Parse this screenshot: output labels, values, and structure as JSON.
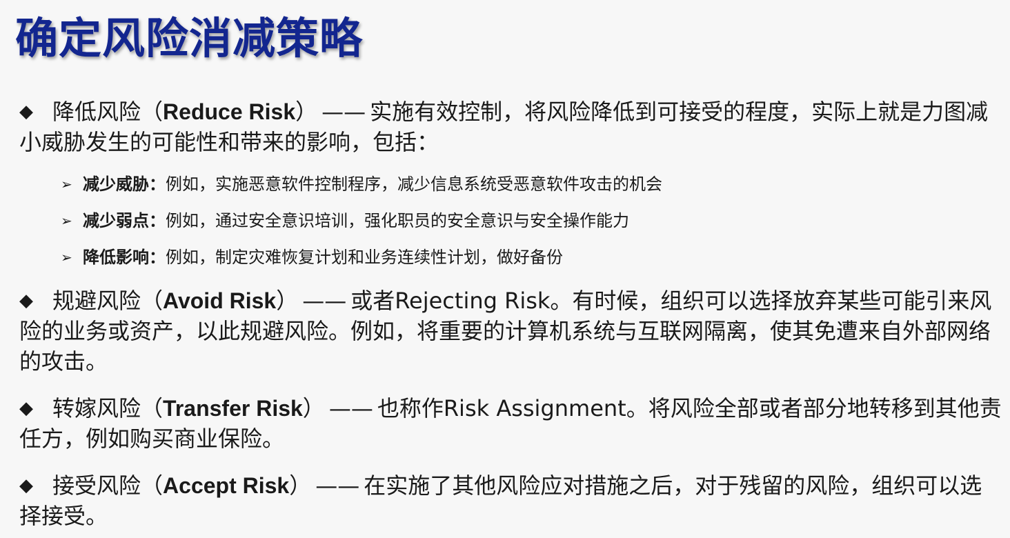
{
  "title": "确定风险消减策略",
  "sections": [
    {
      "name_cn": "降低风险",
      "name_en": "Reduce Risk",
      "description": "实施有效控制，将风险降低到可接受的程度，实际上就是力图减小威胁发生的可能性和带来的影响，包括：",
      "sub_items": [
        {
          "label": "减少威胁：",
          "text": "例如，实施恶意软件控制程序，减少信息系统受恶意软件攻击的机会"
        },
        {
          "label": "减少弱点：",
          "text": "例如，通过安全意识培训，强化职员的安全意识与安全操作能力"
        },
        {
          "label": "降低影响：",
          "text": "例如，制定灾难恢复计划和业务连续性计划，做好备份"
        }
      ]
    },
    {
      "name_cn": "规避风险",
      "name_en": "Avoid Risk",
      "description": "或者Rejecting Risk。有时候，组织可以选择放弃某些可能引来风险的业务或资产，以此规避风险。例如，将重要的计算机系统与互联网隔离，使其免遭来自外部网络的攻击。"
    },
    {
      "name_cn": "转嫁风险",
      "name_en": "Transfer Risk",
      "description": "也称作Risk Assignment。将风险全部或者部分地转移到其他责任方，例如购买商业保险。"
    },
    {
      "name_cn": "接受风险",
      "name_en": "Accept Risk",
      "description": "在实施了其他风险应对措施之后，对于残留的风险，组织可以选择接受。"
    }
  ],
  "symbols": {
    "bullet": "◆",
    "sub_bullet": "➢",
    "open_paren": "（",
    "close_paren": "）",
    "dash": "——"
  },
  "colors": {
    "title": "#13268f",
    "text": "#1a1a1a",
    "background": "#f7f7f7"
  }
}
